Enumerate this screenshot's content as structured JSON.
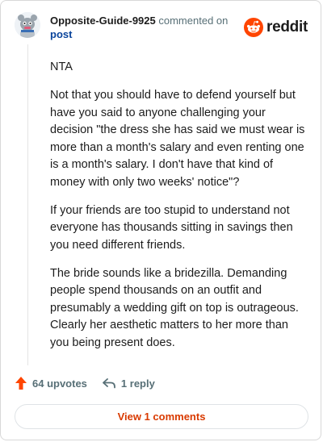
{
  "header": {
    "username": "Opposite-Guide-9925",
    "action_text": "commented on",
    "post_link": "post",
    "logo_text": "reddit"
  },
  "body": {
    "paragraphs": [
      "NTA",
      "Not that you should have to defend yourself but have you said to anyone challenging your decision \"the dress she has said we must wear is more than a month's salary and even renting one is a month's salary. I don't have that kind of money with only two weeks' notice\"?",
      "If your friends are too stupid to understand not everyone has thousands sitting in savings then you need different friends.",
      "The bride sounds like a bridezilla. Demanding people spend thousands on an outfit and presumably a wedding gift on top is outrageous. Clearly her aesthetic matters to her more than you being present does."
    ]
  },
  "actions": {
    "upvotes": "64 upvotes",
    "replies": "1 reply"
  },
  "footer": {
    "view_comments": "View 1 comments"
  },
  "colors": {
    "upvote": "#ff4500",
    "link": "#0a449b",
    "muted": "#576f76",
    "view_button_text": "#d93a00"
  },
  "icons": {
    "avatar": "snoo-avatar",
    "logo": "reddit-logo-icon",
    "upvote": "upvote-arrow-icon",
    "reply": "reply-arrow-icon"
  }
}
